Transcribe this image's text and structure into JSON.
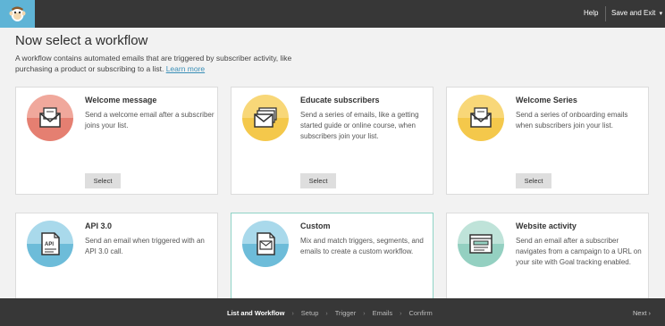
{
  "topbar": {
    "help": "Help",
    "save_exit": "Save and Exit",
    "save_exit_chevron": "▾"
  },
  "heading": {
    "title": "Now select a workflow",
    "description": "A workflow contains automated emails that are triggered by subscriber activity, like purchasing a product or subscribing to a list.",
    "learn_more": "Learn more"
  },
  "cards": [
    {
      "title": "Welcome message",
      "description": "Send a welcome email after a subscriber joins your list.",
      "button": "Select",
      "icon": "envelope-open-icon",
      "color_top": "#f0a89c",
      "color_bottom": "#e57f71"
    },
    {
      "title": "Educate subscribers",
      "description": "Send a series of emails, like a getting started guide or online course, when subscribers join your list.",
      "button": "Select",
      "icon": "envelope-stack-icon",
      "color_top": "#f8d778",
      "color_bottom": "#f4c84b"
    },
    {
      "title": "Welcome Series",
      "description": "Send a series of onboarding emails when subscribers join your list.",
      "button": "Select",
      "icon": "envelope-open-icon",
      "color_top": "#f8d778",
      "color_bottom": "#f4c84b"
    },
    {
      "title": "API 3.0",
      "description": "Send an email when triggered with an API 3.0 call.",
      "icon": "api-document-icon",
      "icon_text": "API",
      "color_top": "#a9d9eb",
      "color_bottom": "#6dbcd9"
    },
    {
      "title": "Custom",
      "description": "Mix and match triggers, segments, and emails to create a custom workflow.",
      "icon": "envelope-document-icon",
      "color_top": "#a9d9eb",
      "color_bottom": "#6dbcd9"
    },
    {
      "title": "Website activity",
      "description": "Send an email after a subscriber navigates from a campaign to a URL on your site with Goal tracking enabled.",
      "icon": "browser-window-icon",
      "color_top": "#bfe3d9",
      "color_bottom": "#94d0c1"
    }
  ],
  "steps": [
    {
      "label": "List and Workflow",
      "active": true
    },
    {
      "label": "Setup",
      "active": false
    },
    {
      "label": "Trigger",
      "active": false
    },
    {
      "label": "Emails",
      "active": false
    },
    {
      "label": "Confirm",
      "active": false
    }
  ],
  "step_separator": "›",
  "next": "Next",
  "next_chevron": "›",
  "colors": {
    "topbar": "#373737",
    "logo_bg": "#5fb4d6",
    "link": "#3a8fb7",
    "selected_border": "#8fd3c6"
  }
}
